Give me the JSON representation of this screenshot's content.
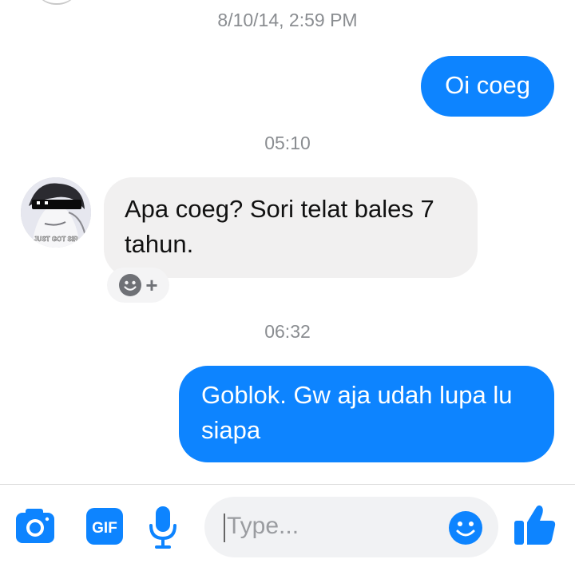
{
  "conversation": {
    "messages": [
      {
        "timestamp": "8/10/14, 2:59 PM",
        "direction": "outgoing",
        "text": "Oi coeg"
      },
      {
        "timestamp": "05:10",
        "direction": "incoming",
        "text": "Apa coeg? Sori telat bales 7 tahun.",
        "avatar_caption": "JUST GOT SIR"
      },
      {
        "timestamp": "06:32",
        "direction": "outgoing",
        "text": "Goblok. Gw aja udah lupa lu siapa"
      }
    ]
  },
  "reaction": {
    "icon": "smiley-icon",
    "add_label": "+"
  },
  "composer": {
    "gif_label": "GIF",
    "placeholder": "Type...",
    "icons": [
      "camera-icon",
      "gif-icon",
      "microphone-icon",
      "emoji-icon",
      "thumbs-up-icon"
    ]
  },
  "colors": {
    "outgoing_bubble": "#0d84ff",
    "incoming_bubble": "#f1f0f0",
    "accent": "#0d84ff",
    "timestamp_text": "#8a8d91"
  }
}
